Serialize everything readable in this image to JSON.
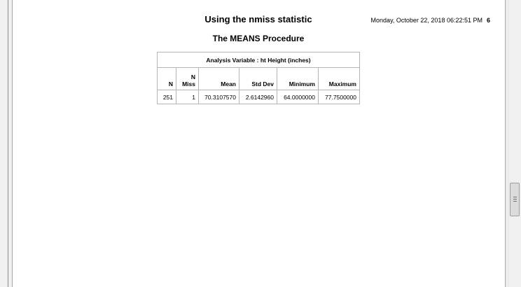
{
  "page": {
    "title": "Using the nmiss statistic",
    "timestamp": "Monday, October 22, 2018 06:22:51 PM",
    "page_number": "6",
    "procedure_title": "The MEANS Procedure"
  },
  "table": {
    "caption": "Analysis Variable : ht Height (inches)",
    "columns": [
      {
        "line1": "",
        "line2": "N"
      },
      {
        "line1": "N",
        "line2": "Miss"
      },
      {
        "line1": "",
        "line2": "Mean"
      },
      {
        "line1": "",
        "line2": "Std Dev"
      },
      {
        "line1": "",
        "line2": "Minimum"
      },
      {
        "line1": "",
        "line2": "Maximum"
      }
    ],
    "rows": [
      [
        "251",
        "1",
        "70.3107570",
        "2.6142960",
        "64.0000000",
        "77.7500000"
      ]
    ]
  },
  "scrollbar": {
    "grip_icon": "grip-lines-icon"
  }
}
